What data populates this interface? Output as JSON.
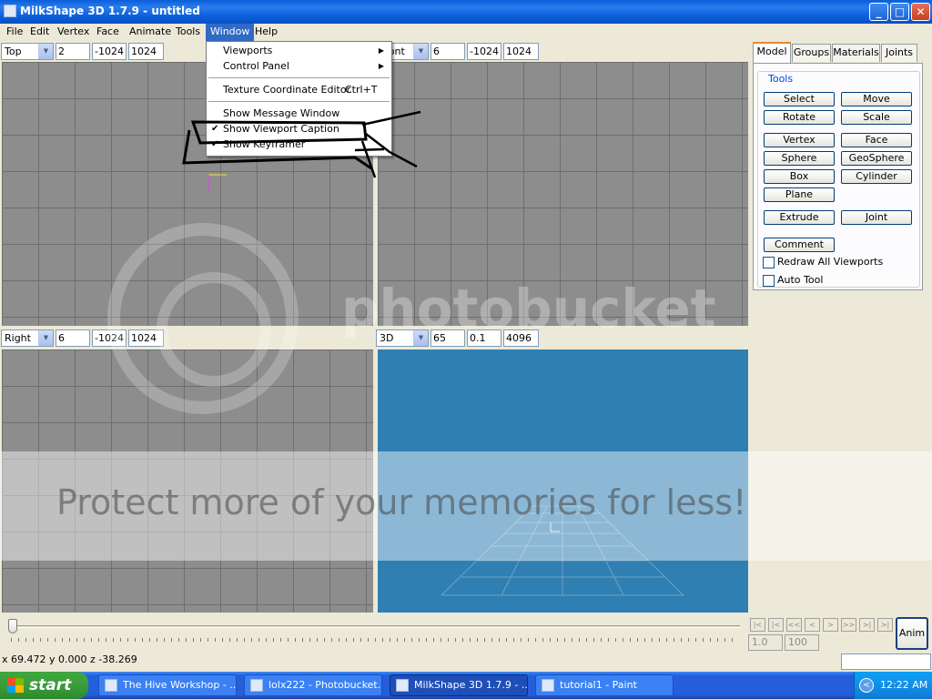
{
  "window": {
    "title": "MilkShape 3D 1.7.9 - untitled",
    "controls": {
      "minimize": "_",
      "maximize": "□",
      "close": "✕"
    }
  },
  "menubar": [
    "File",
    "Edit",
    "Vertex",
    "Face",
    "Animate",
    "Tools",
    "Window",
    "Help"
  ],
  "window_menu": {
    "items": [
      {
        "label": "Viewports",
        "submenu": true
      },
      {
        "label": "Control Panel",
        "submenu": true
      },
      {
        "label": "Texture Coordinate Editor",
        "shortcut": "Ctrl+T"
      },
      {
        "label": "Show Message Window"
      },
      {
        "label": "Show Viewport Caption",
        "checked": true
      },
      {
        "label": "Show Keyframer",
        "checked": true
      }
    ],
    "check_glyph": "✔",
    "arrow_glyph": "▶"
  },
  "viewports": [
    {
      "view": "Top",
      "v1": "2",
      "v2": "-1024",
      "v3": "1024"
    },
    {
      "view": "Front",
      "v1": "6",
      "v2": "-1024",
      "v3": "1024"
    },
    {
      "view": "Right",
      "v1": "6",
      "v2": "-1024",
      "v3": "1024"
    },
    {
      "view": "3D",
      "v1": "65",
      "v2": "0.1",
      "v3": "4096"
    }
  ],
  "panel": {
    "tabs": [
      "Model",
      "Groups",
      "Materials",
      "Joints"
    ],
    "active_tab": "Model",
    "group_title": "Tools",
    "buttons": [
      "Select",
      "Move",
      "Rotate",
      "Scale",
      "Vertex",
      "Face",
      "Sphere",
      "GeoSphere",
      "Box",
      "Cylinder",
      "Plane",
      "Extrude",
      "Joint",
      "Comment"
    ],
    "checkboxes": [
      {
        "label": "Redraw All Viewports",
        "checked": false
      },
      {
        "label": "Auto Tool",
        "checked": false
      }
    ]
  },
  "timeline": {
    "position": 0,
    "nav": [
      "|<",
      "|<",
      "<<",
      "<",
      ">",
      ">>",
      ">|",
      ">|"
    ],
    "frame_current": "1.0",
    "frame_total": "100",
    "anim_label": "Anim"
  },
  "status": {
    "coords": "x 69.472 y 0.000 z -38.269"
  },
  "taskbar": {
    "start_label": "start",
    "tasks": [
      {
        "label": "The Hive Workshop - ...",
        "active": false
      },
      {
        "label": "lolx222 - Photobucket...",
        "active": false
      },
      {
        "label": "MilkShape 3D 1.7.9 - ...",
        "active": true
      },
      {
        "label": "tutorial1 - Paint",
        "active": false
      }
    ],
    "tray_icon": "<",
    "clock": "12:22 AM"
  },
  "watermark": {
    "brand": "photobucket",
    "tagline": "Protect more of your memories for less!"
  },
  "colors": {
    "viewport_grid": "#8d8d8d",
    "viewport_3d": "#2f7fb2",
    "selection_blue": "#316ac5",
    "tab_accent": "#e68b2c"
  }
}
